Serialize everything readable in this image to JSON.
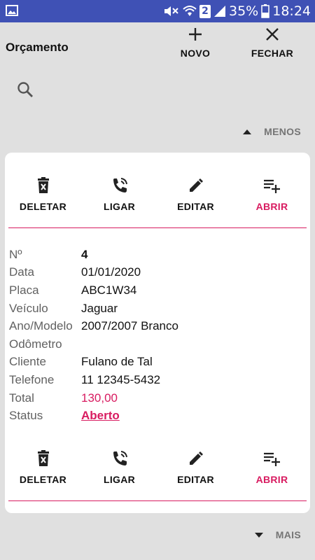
{
  "status_bar": {
    "battery": "35%",
    "time": "18:24",
    "sim_number": "2",
    "icons": [
      "gallery-icon",
      "mute-icon",
      "wifi-icon",
      "signal-icon",
      "battery-icon"
    ]
  },
  "toolbar": {
    "title": "Orçamento",
    "new_label": "NOVO",
    "close_label": "FECHAR"
  },
  "toggle": {
    "less_label": "MENOS",
    "more_label": "MAIS"
  },
  "card": {
    "actions": {
      "delete": "DELETAR",
      "call": "LIGAR",
      "edit": "EDITAR",
      "open": "ABRIR"
    },
    "fields": [
      {
        "label": "Nº",
        "value": "4"
      },
      {
        "label": "Data",
        "value": "01/01/2020"
      },
      {
        "label": "Placa",
        "value": "ABC1W34"
      },
      {
        "label": "Veículo",
        "value": "Jaguar"
      },
      {
        "label": "Ano/Modelo",
        "value": "2007/2007 Branco"
      },
      {
        "label": "Odômetro",
        "value": ""
      },
      {
        "label": "Cliente",
        "value": "Fulano de Tal"
      },
      {
        "label": "Telefone",
        "value": "11 12345-5432"
      },
      {
        "label": "Total",
        "value": "130,00"
      },
      {
        "label": "Status",
        "value": "Aberto"
      }
    ]
  },
  "colors": {
    "status_bar": "#3f51b5",
    "accent": "#d81b60",
    "background": "#e0e0e0"
  }
}
